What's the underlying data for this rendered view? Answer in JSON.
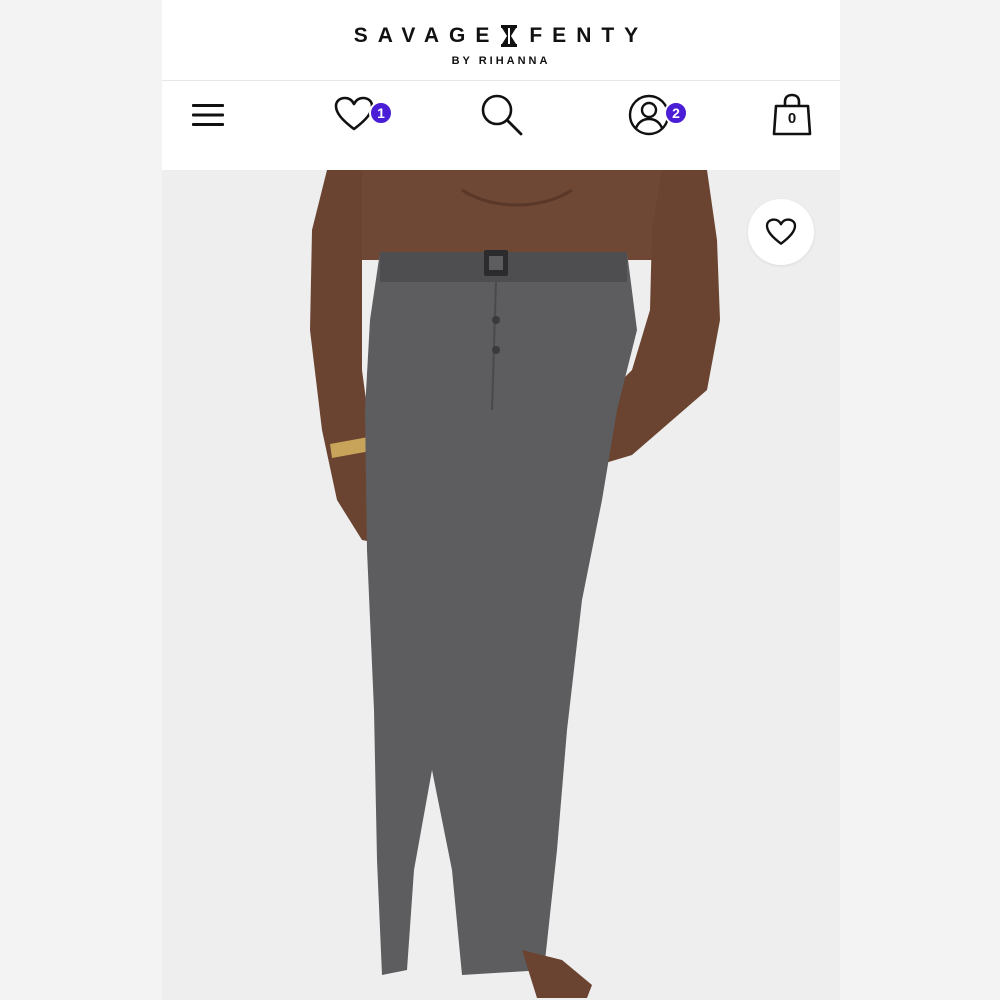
{
  "brand": {
    "name_left": "SAVAGE",
    "name_right": "FENTY",
    "tagline": "BY RIHANNA"
  },
  "nav": {
    "menu_icon": "hamburger-menu-icon",
    "wishlist_icon": "heart-icon",
    "wishlist_count": "1",
    "search_icon": "search-icon",
    "account_icon": "user-icon",
    "account_count": "2",
    "cart_icon": "shopping-bag-icon",
    "cart_count": "0"
  },
  "product": {
    "image_subject": "product-photo",
    "wishlist_button_icon": "heart-outline-icon"
  },
  "colors": {
    "badge": "#4a1dd6",
    "text": "#111111",
    "pants": "#5d5d60",
    "skin": "#6b4431"
  }
}
